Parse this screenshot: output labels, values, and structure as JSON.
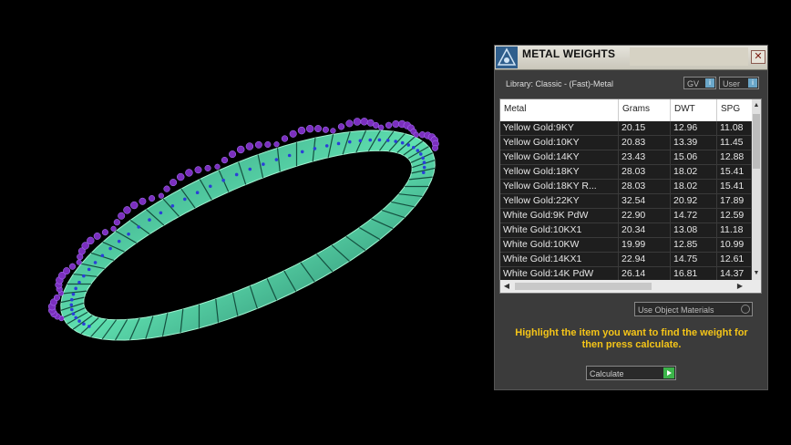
{
  "viewport": {
    "scene": "3d-ring-model",
    "colors": {
      "band": "#3fbf95",
      "gems": "#7b2fbf",
      "pave": "#2b3fd8"
    }
  },
  "panel": {
    "title": "METAL WEIGHTS",
    "library_label": "Library: Classic - (Fast)-Metal",
    "toggles": {
      "gv": "GV",
      "user": "User",
      "info_glyph": "i"
    },
    "table": {
      "headers": [
        "Metal",
        "Grams",
        "DWT",
        "SPG"
      ],
      "rows": [
        [
          "Yellow Gold:9KY",
          "20.15",
          "12.96",
          "11.08"
        ],
        [
          "Yellow Gold:10KY",
          "20.83",
          "13.39",
          "11.45"
        ],
        [
          "Yellow Gold:14KY",
          "23.43",
          "15.06",
          "12.88"
        ],
        [
          "Yellow Gold:18KY",
          "28.03",
          "18.02",
          "15.41"
        ],
        [
          "Yellow Gold:18KY R...",
          "28.03",
          "18.02",
          "15.41"
        ],
        [
          "Yellow Gold:22KY",
          "32.54",
          "20.92",
          "17.89"
        ],
        [
          "White Gold:9K PdW",
          "22.90",
          "14.72",
          "12.59"
        ],
        [
          "White Gold:10KX1",
          "20.34",
          "13.08",
          "11.18"
        ],
        [
          "White Gold:10KW",
          "19.99",
          "12.85",
          "10.99"
        ],
        [
          "White Gold:14KX1",
          "22.94",
          "14.75",
          "12.61"
        ],
        [
          "White Gold:14K PdW",
          "26.14",
          "16.81",
          "14.37"
        ]
      ]
    },
    "use_object_materials": "Use Object Materials",
    "instructions": "Highlight the item you want to find the weight for then press calculate.",
    "calculate_label": "Calculate",
    "close_glyph": "✕"
  }
}
